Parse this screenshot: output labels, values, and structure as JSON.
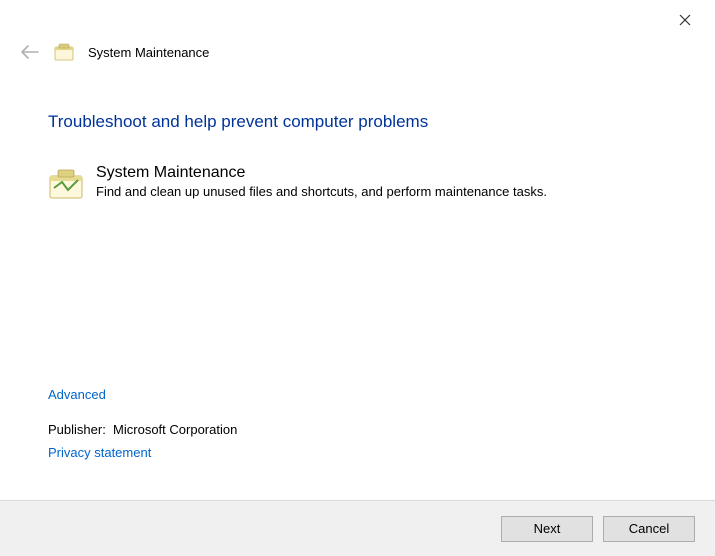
{
  "window": {
    "title": "System Maintenance"
  },
  "main": {
    "heading": "Troubleshoot and help prevent computer problems",
    "item": {
      "title": "System Maintenance",
      "description": "Find and clean up unused files and shortcuts, and perform maintenance tasks."
    }
  },
  "footer": {
    "advanced_link": "Advanced",
    "publisher_label": "Publisher:",
    "publisher_value": "Microsoft Corporation",
    "privacy_link": "Privacy statement"
  },
  "buttons": {
    "next": "Next",
    "cancel": "Cancel"
  }
}
